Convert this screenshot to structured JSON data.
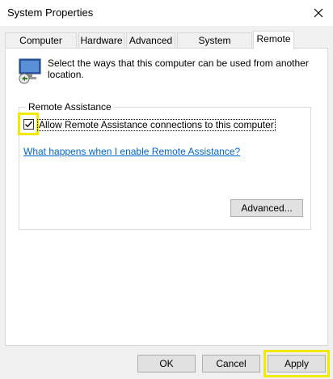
{
  "window": {
    "title": "System Properties"
  },
  "tabs": [
    {
      "label": "Computer Name"
    },
    {
      "label": "Hardware"
    },
    {
      "label": "Advanced"
    },
    {
      "label": "System Protection"
    },
    {
      "label": "Remote"
    }
  ],
  "active_tab": "Remote",
  "intro": {
    "text": "Select the ways that this computer can be used from another location."
  },
  "remote_assistance": {
    "legend": "Remote Assistance",
    "checkbox_label": "Allow Remote Assistance connections to this computer",
    "checked": true,
    "help_link": "What happens when I enable Remote Assistance?",
    "advanced_button": "Advanced..."
  },
  "footer": {
    "ok_label": "OK",
    "cancel_label": "Cancel",
    "apply_label": "Apply"
  },
  "colors": {
    "highlight": "#f2e800",
    "link": "#0066cc",
    "panel": "#ffffff",
    "window": "#f0f0f0"
  },
  "icons": {
    "close": "close-icon",
    "computer": "remote-computer-icon",
    "check": "checkmark-icon"
  }
}
